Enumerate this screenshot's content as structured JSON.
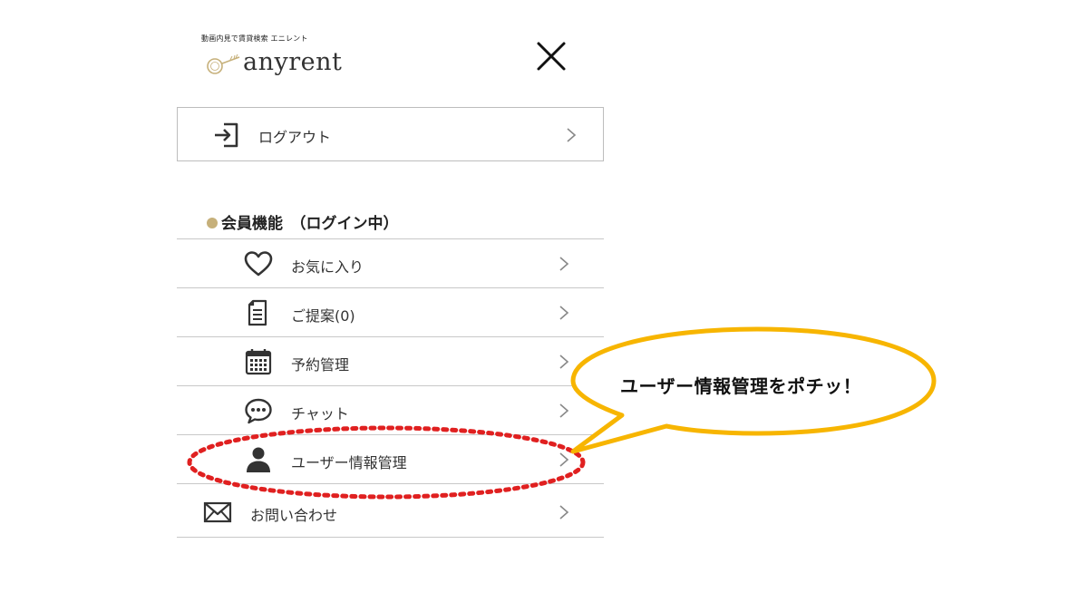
{
  "header": {
    "tagline": "動画内見で賃貸検索 エニレント",
    "brand": "anyrent"
  },
  "logout": {
    "label": "ログアウト"
  },
  "member_section": {
    "heading": "会員機能　（ログイン中）",
    "items": [
      {
        "label": "お気に入り",
        "icon": "heart-icon"
      },
      {
        "label": "ご提案(0)",
        "icon": "document-icon"
      },
      {
        "label": "予約管理",
        "icon": "calendar-icon"
      },
      {
        "label": "チャット",
        "icon": "chat-bubble-icon"
      },
      {
        "label": "ユーザー情報管理",
        "icon": "user-icon"
      },
      {
        "label": "お問い合わせ",
        "icon": "envelope-icon"
      }
    ]
  },
  "callout": {
    "text": "ユーザー情報管理をポチッ！"
  },
  "colors": {
    "accent_gold": "#c6b07a",
    "callout_yellow": "#f7b500",
    "highlight_red": "#e02020",
    "divider": "#c8c8c8"
  }
}
